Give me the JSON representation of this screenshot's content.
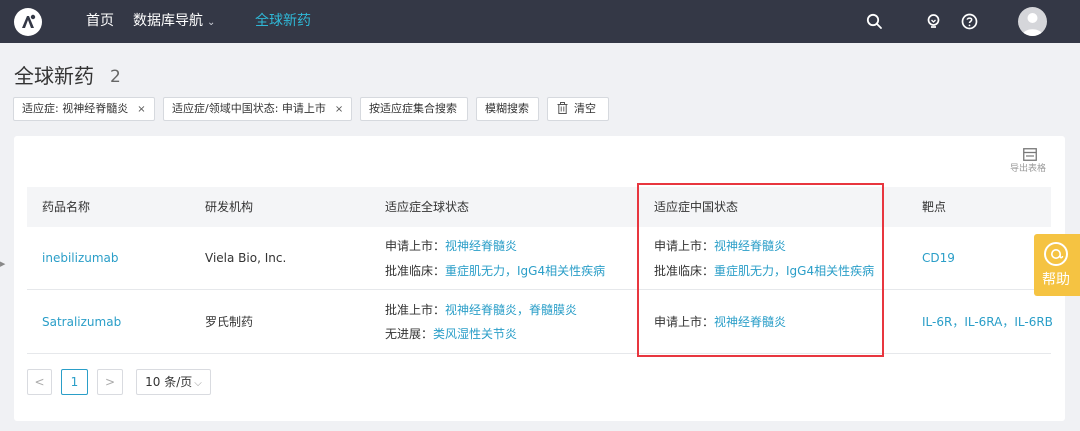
{
  "nav": {
    "home": "首页",
    "database_nav": "数据库导航",
    "database_caret": "⌄",
    "active": "全球新药"
  },
  "header": {
    "title": "全球新药",
    "count": "2"
  },
  "filters": {
    "chip1": "适应症: 视神经脊髓炎",
    "chip2": "适应症/领域中国状态: 申请上市",
    "close": "×",
    "set_search": "按适应症集合搜索",
    "fuzzy_search": "模糊搜索",
    "clear": "清空"
  },
  "toolbar": {
    "export": "导出表格"
  },
  "table": {
    "headers": [
      "药品名称",
      "研发机构",
      "适应症全球状态",
      "适应症中国状态",
      "靶点"
    ],
    "rows": [
      {
        "name": "inebilizumab",
        "org": "Viela Bio, Inc.",
        "global": [
          {
            "label": "申请上市：",
            "links": "视神经脊髓炎"
          },
          {
            "label": "批准临床：",
            "links": "重症肌无力，IgG4相关性疾病"
          }
        ],
        "china": [
          {
            "label": "申请上市：",
            "links": "视神经脊髓炎"
          },
          {
            "label": "批准临床：",
            "links": "重症肌无力，IgG4相关性疾病"
          }
        ],
        "target": "CD19"
      },
      {
        "name": "Satralizumab",
        "org": "罗氏制药",
        "global": [
          {
            "label": "批准上市：",
            "links": "视神经脊髓炎，脊髓膜炎"
          },
          {
            "label": "无进展：",
            "links": "类风湿性关节炎"
          }
        ],
        "china": [
          {
            "label": "申请上市：",
            "links": "视神经脊髓炎"
          }
        ],
        "target": "IL-6R，IL-6RA，IL-6RB"
      }
    ]
  },
  "pagination": {
    "prev": "<",
    "current": "1",
    "next": ">",
    "page_size": "10 条/页"
  },
  "help_widget": {
    "label": "帮助"
  },
  "colors": {
    "topbar": "#343846",
    "accent": "#2fb8d7",
    "link": "#2a9ec8",
    "highlight_box": "#e8363f",
    "help": "#f5c342"
  }
}
